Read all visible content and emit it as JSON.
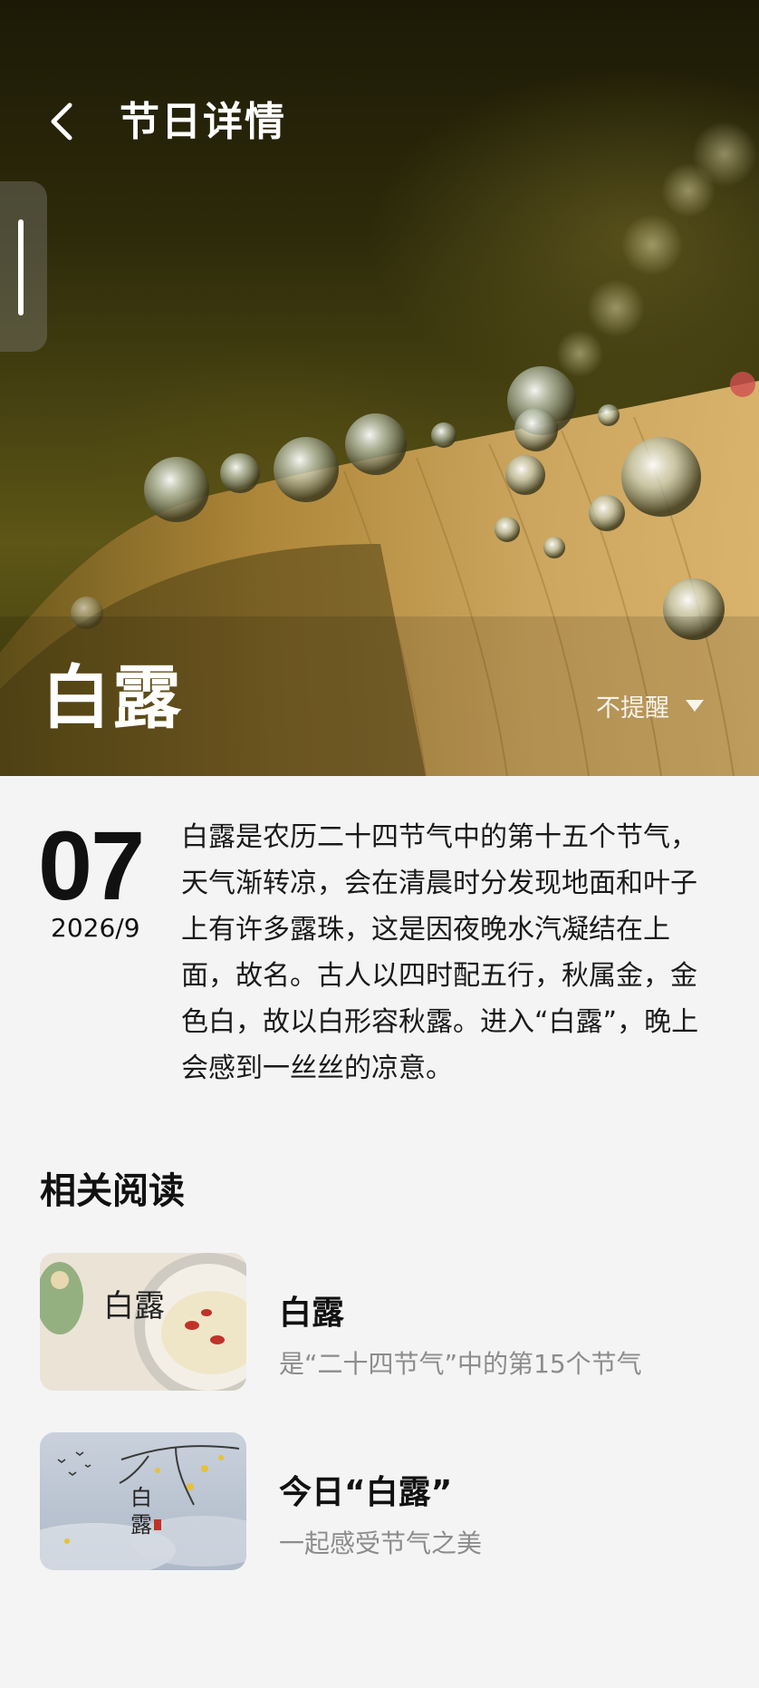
{
  "header": {
    "back_icon": "chevron-left-icon",
    "title": "节日详情"
  },
  "hero": {
    "name": "白露",
    "reminder_label": "不提醒",
    "reminder_icon": "triangle-down-icon"
  },
  "detail": {
    "day": "07",
    "year_month": "2026/9",
    "description": "白露是农历二十四节气中的第十五个节气，天气渐转凉，会在清晨时分发现地面和叶子上有许多露珠，这是因夜晚水汽凝结在上面，故名。古人以四时配五行，秋属金，金色白，故以白形容秋露。进入“白露”，晚上会感到一丝丝的凉意。"
  },
  "related": {
    "title": "相关阅读",
    "items": [
      {
        "title": "白露",
        "subtitle": "是“二十四节气”中的第15个节气",
        "thumb_text": "白露"
      },
      {
        "title": "今日“白露”",
        "subtitle": "一起感受节气之美",
        "thumb_text_1": "白",
        "thumb_text_2": "露"
      }
    ]
  },
  "colors": {
    "background": "#f4f4f4",
    "text_primary": "#111111",
    "text_secondary": "#8c8c8c",
    "hero_dark": "#2d2a0a",
    "leaf": "#c9a35a"
  }
}
